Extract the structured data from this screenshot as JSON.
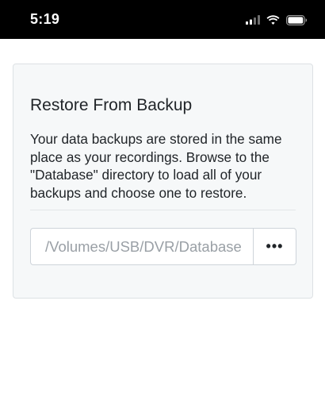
{
  "status_bar": {
    "time": "5:19",
    "icons": [
      "cellular-signal-icon",
      "wifi-icon",
      "battery-icon"
    ]
  },
  "card": {
    "title": "Restore From Backup",
    "description": "Your data backups are stored in the same place as your recordings. Browse to the \"Database\" directory to load all of your backups and choose one to restore.",
    "path_input": {
      "value": "/Volumes/USB/DVR/Database",
      "placeholder": "/Volumes/USB/DVR/Database"
    },
    "browse_button": {
      "label": "•••"
    }
  },
  "colors": {
    "status_bar_bg": "#000000",
    "card_bg": "#f6f8f9",
    "card_border": "#dde1e4",
    "text": "#212529",
    "input_text": "#9aa0a6"
  }
}
